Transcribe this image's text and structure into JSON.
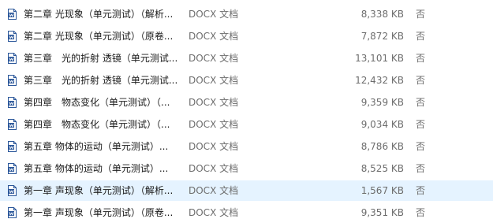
{
  "colors": {
    "selected_row_background": "#e5f3ff",
    "word_icon_blue": "#2b579a"
  },
  "icon": "word-document-icon",
  "files": [
    {
      "name": "第二章 光现象（单元测试）（解析...",
      "type": "DOCX 文档",
      "size": "8,338 KB",
      "flag": "否",
      "selected": false
    },
    {
      "name": "第二章 光现象（单元测试）（原卷...",
      "type": "DOCX 文档",
      "size": "7,872 KB",
      "flag": "否",
      "selected": false
    },
    {
      "name": "第三章　光的折射 透镜（单元测试...",
      "type": "DOCX 文档",
      "size": "13,101 KB",
      "flag": "否",
      "selected": false
    },
    {
      "name": "第三章　光的折射 透镜（单元测试...",
      "type": "DOCX 文档",
      "size": "12,432 KB",
      "flag": "否",
      "selected": false
    },
    {
      "name": "第四章　物态变化（单元测试）（...",
      "type": "DOCX 文档",
      "size": "9,359 KB",
      "flag": "否",
      "selected": false
    },
    {
      "name": "第四章　物态变化（单元测试）（...",
      "type": "DOCX 文档",
      "size": "9,034 KB",
      "flag": "否",
      "selected": false
    },
    {
      "name": "第五章 物体的运动（单元测试）...",
      "type": "DOCX 文档",
      "size": "8,786 KB",
      "flag": "否",
      "selected": false
    },
    {
      "name": "第五章 物体的运动（单元测试）...",
      "type": "DOCX 文档",
      "size": "8,525 KB",
      "flag": "否",
      "selected": false
    },
    {
      "name": "第一章 声现象（单元测试）（解析...",
      "type": "DOCX 文档",
      "size": "1,567 KB",
      "flag": "否",
      "selected": true
    },
    {
      "name": "第一章 声现象（单元测试）（原卷...",
      "type": "DOCX 文档",
      "size": "9,351 KB",
      "flag": "否",
      "selected": false
    }
  ]
}
